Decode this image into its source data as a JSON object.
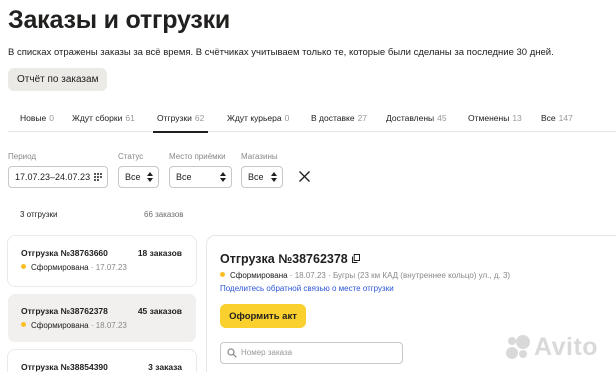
{
  "header": {
    "title": "Заказы и отгрузки",
    "subtitle": "В списках отражены заказы за всё время. В счётчиках учитываем только те, которые были сделаны за последние 30 дней.",
    "report_button": "Отчёт по заказам"
  },
  "tabs": [
    {
      "label": "Новые",
      "count": "0"
    },
    {
      "label": "Ждут сборки",
      "count": "61"
    },
    {
      "label": "Отгрузки",
      "count": "62",
      "active": true
    },
    {
      "label": "Ждут курьера",
      "count": "0"
    },
    {
      "label": "В доставке",
      "count": "27"
    },
    {
      "label": "Доставлены",
      "count": "45"
    },
    {
      "label": "Отменены",
      "count": "13"
    },
    {
      "label": "Все",
      "count": "147"
    }
  ],
  "filters": {
    "period": {
      "label": "Период",
      "value": "17.07.23–24.07.23"
    },
    "status": {
      "label": "Статус",
      "value": "Все"
    },
    "place": {
      "label": "Место приёмки",
      "value": "Все"
    },
    "stores": {
      "label": "Магазины",
      "value": "Все"
    }
  },
  "list": {
    "count_label": "3 отгрузки",
    "orders_label": "66 заказов",
    "shipments": [
      {
        "number": "Отгрузка №38763660",
        "orders": "18 заказов",
        "status": "Сформирована",
        "date": "· 17.07.23"
      },
      {
        "number": "Отгрузка №38762378",
        "orders": "45 заказов",
        "status": "Сформирована",
        "date": "· 18.07.23",
        "selected": true
      },
      {
        "number": "Отгрузка №38854390",
        "orders": "3 заказа",
        "status": "",
        "date": ""
      }
    ]
  },
  "detail": {
    "title": "Отгрузка №38762378",
    "status": "Сформирована",
    "meta": "· 18.07.23 · Бугры (23 км КАД (внутреннее кольцо) ул., д. 3)",
    "feedback_link": "Поделитесь обратной связью о месте отгрузки",
    "primary_button": "Оформить акт",
    "search_placeholder": "Номер заказа"
  },
  "watermark": "Avito",
  "colors": {
    "accent": "#fad02e",
    "status_dot": "#fbbf24",
    "link": "#2c55d6"
  }
}
